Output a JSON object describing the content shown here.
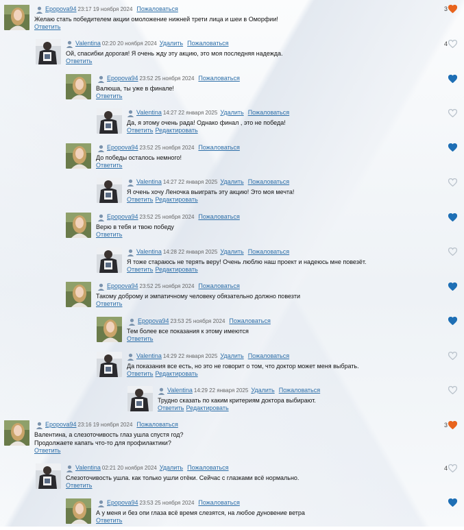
{
  "actions": {
    "reply": "Ответить",
    "delete": "Удалить",
    "report": "Пожаловаться",
    "edit": "Редактировать"
  },
  "icons": {
    "user": "user-icon",
    "like": "heart-icon"
  },
  "colors": {
    "link": "#2c6ea8",
    "heart_active": "#e8641e",
    "heart_liked": "#1e6fb5",
    "heart_empty": "#b9c2cb"
  },
  "comments": [
    {
      "author": "Epopova94",
      "avatar": "girl",
      "date": "23:17 19 ноября 2024",
      "lines": [
        "Желаю стать победителем акции омоложение нижней трети лица и шеи в Оморфии!"
      ],
      "actions": [
        "reply"
      ],
      "own": false,
      "like_count": "3",
      "like_state": "active"
    },
    {
      "author": "Valentina",
      "avatar": "man",
      "date": "02:20 20 ноября 2024",
      "lines": [
        "Ой, спасибки дорогая! Я очень жду эту акцию, это моя последняя надежда."
      ],
      "actions": [
        "reply"
      ],
      "own": true,
      "like_count": "4",
      "like_state": "empty"
    },
    {
      "author": "Epopova94",
      "avatar": "girl",
      "date": "23:52 25 ноября 2024",
      "lines": [
        "Валюша, ты уже в финале!"
      ],
      "actions": [
        "reply"
      ],
      "own": false,
      "like_count": "",
      "like_state": "liked"
    },
    {
      "author": "Valentina",
      "avatar": "man",
      "date": "14:27 22 января 2025",
      "lines": [
        "Да, я этому очень рада! Однако финал , это не победа!"
      ],
      "actions": [
        "reply",
        "edit"
      ],
      "own": true,
      "like_count": "",
      "like_state": "empty"
    },
    {
      "author": "Epopova94",
      "avatar": "girl",
      "date": "23:52 25 ноября 2024",
      "lines": [
        "До победы осталось немного!"
      ],
      "actions": [
        "reply"
      ],
      "own": false,
      "like_count": "",
      "like_state": "liked"
    },
    {
      "author": "Valentina",
      "avatar": "man",
      "date": "14:27 22 января 2025",
      "lines": [
        "Я очень хочу Леночка выиграть эту акцию! Это моя мечта!"
      ],
      "actions": [
        "reply",
        "edit"
      ],
      "own": true,
      "like_count": "",
      "like_state": "empty"
    },
    {
      "author": "Epopova94",
      "avatar": "girl",
      "date": "23:52 25 ноября 2024",
      "lines": [
        "Верю в тебя и твою победу"
      ],
      "actions": [
        "reply"
      ],
      "own": false,
      "like_count": "",
      "like_state": "liked"
    },
    {
      "author": "Valentina",
      "avatar": "man",
      "date": "14:28 22 января 2025",
      "lines": [
        "Я тоже стараюсь не терять веру! Очень люблю наш проект и надеюсь мне повезёт."
      ],
      "actions": [
        "reply",
        "edit"
      ],
      "own": true,
      "like_count": "",
      "like_state": "empty"
    },
    {
      "author": "Epopova94",
      "avatar": "girl",
      "date": "23:52 25 ноября 2024",
      "lines": [
        "Такому доброму и эмпатичному человеку обязательно должно повезти"
      ],
      "actions": [
        "reply"
      ],
      "own": false,
      "like_count": "",
      "like_state": "liked"
    },
    {
      "author": "Epopova94",
      "avatar": "girl",
      "date": "23:53 25 ноября 2024",
      "lines": [
        "Тем более все показания к этому имеются"
      ],
      "actions": [
        "reply"
      ],
      "own": false,
      "like_count": "",
      "like_state": "liked"
    },
    {
      "author": "Valentina",
      "avatar": "man",
      "date": "14:29 22 января 2025",
      "lines": [
        "Да показания все есть, но это не говорит о том, что доктор может меня выбрать."
      ],
      "actions": [
        "reply",
        "edit"
      ],
      "own": true,
      "like_count": "",
      "like_state": "empty"
    },
    {
      "author": "Valentina",
      "avatar": "man",
      "date": "14:29 22 января 2025",
      "lines": [
        "Трудно сказать по каким критериям доктора выбирают."
      ],
      "actions": [
        "reply",
        "edit"
      ],
      "own": true,
      "like_count": "",
      "like_state": "empty"
    },
    {
      "author": "Epopova94",
      "avatar": "girl",
      "date": "23:16 19 ноября 2024",
      "lines": [
        "Валентина, а слезоточивость глаз ушла спустя год?",
        "Продолжаете капать что-то для профилактики?"
      ],
      "actions": [
        "reply"
      ],
      "own": false,
      "like_count": "3",
      "like_state": "active"
    },
    {
      "author": "Valentina",
      "avatar": "man",
      "date": "02:21 20 ноября 2024",
      "lines": [
        "Слезоточивость ушла. как только ушли отёки. Сейчас с глазками всё нормально."
      ],
      "actions": [
        "reply"
      ],
      "own": true,
      "like_count": "4",
      "like_state": "empty"
    },
    {
      "author": "Epopova94",
      "avatar": "girl",
      "date": "23:53 25 ноября 2024",
      "lines": [
        "А у меня и без опи глаза всё время слезятся, на любое дуновение ветра"
      ],
      "actions": [
        "reply"
      ],
      "own": false,
      "like_count": "",
      "like_state": "liked"
    }
  ]
}
